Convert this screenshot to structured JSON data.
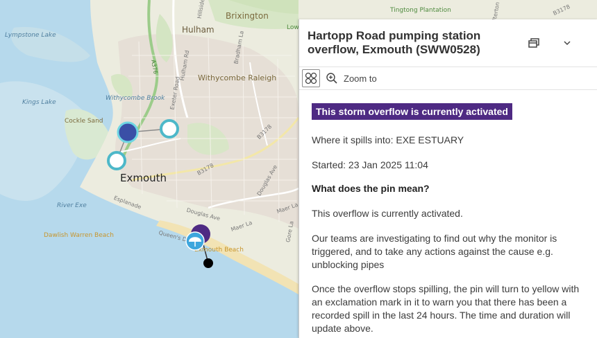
{
  "map": {
    "labels": {
      "brixington": "Brixington",
      "hulham": "Hulham",
      "withycombe_raleigh": "Withycombe Raleigh",
      "exmouth": "Exmouth",
      "lympstone_lake": "Lympstone Lake",
      "kings_lake": "Kings Lake",
      "cockle_sand": "Cockle Sand",
      "withycombe_brook": "Withycombe Brook",
      "river_exe": "River Exe",
      "dawlish_warren_beach": "Dawlish Warren Beach",
      "exmouth_beach": "Exmouth Beach",
      "tingtong_plantation": "Tingtong Plantation",
      "low": "Low",
      "road_b3178_a": "B3178",
      "road_b3178_b": "B3178",
      "road_b3178_c": "B3178",
      "road_a376": "A376",
      "exeter_road": "Exeter Road",
      "hulham_road": "Hulham Rd",
      "douglas_ave_a": "Douglas Ave",
      "douglas_ave_b": "Douglas Ave",
      "maer_la_a": "Maer La",
      "maer_la_b": "Maer La",
      "gore_la": "Gore La",
      "esplanade": "Esplanade",
      "queens_dr": "Queen's Dr",
      "bradham_la": "Bradham La",
      "hillside": "Hillside",
      "salterton_rd": "Salterton Rd"
    },
    "pins": {
      "activated_color": "#4e2a83",
      "clear_color": "#4db8c9",
      "selected_color": "#3a4fa6",
      "beach_icon": "umbrella-icon"
    }
  },
  "panel": {
    "title": "Hartopp Road pumping station overflow, Exmouth (SWW0528)",
    "zoom_to": "Zoom to",
    "status_badge": "This storm overflow is currently activated",
    "spills_into": "Where it spills into: EXE ESTUARY",
    "started": "Started: 23 Jan 2025 11:04",
    "pin_heading": "What does the pin mean?",
    "pin_text": "This overflow is currently activated.",
    "teams_text": "Our teams are investigating to find out why the monitor is triggered, and to take any actions against the cause e.g. unblocking pipes",
    "once_text": "Once the overflow stops spilling, the pin will turn to yellow with an exclamation mark in it to warn you that there has been a recorded spill in the last 24 hours. The time and duration will update above.",
    "icons": {
      "dock": "dock-icon",
      "collapse": "chevron-down-icon",
      "grid": "grid-icon",
      "zoom": "zoom-in-icon"
    }
  }
}
